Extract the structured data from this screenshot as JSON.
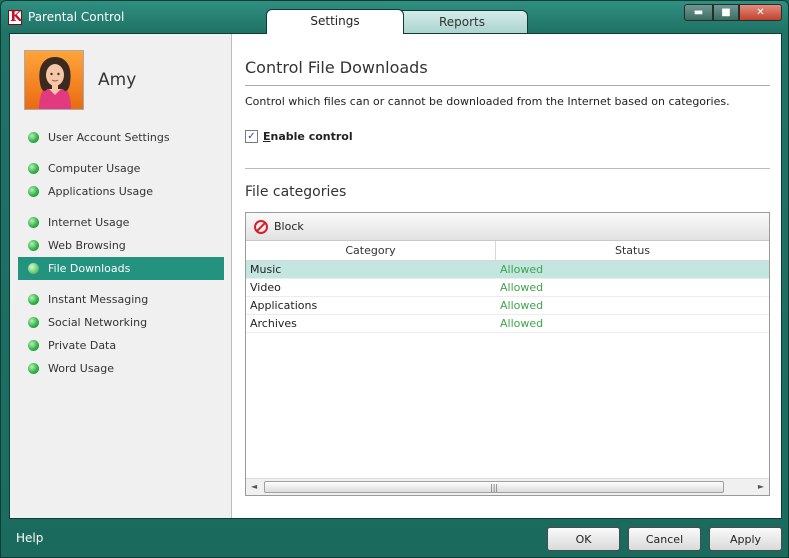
{
  "window": {
    "title": "Parental Control",
    "logo_letter": "K",
    "tabs": [
      {
        "label": "Settings",
        "active": true
      },
      {
        "label": "Reports",
        "active": false
      }
    ],
    "controls": {
      "minimize": "▬",
      "maximize": "■",
      "close": "✕"
    }
  },
  "sidebar": {
    "user_name": "Amy",
    "items": [
      {
        "label": "User Account Settings",
        "active": false
      },
      {
        "label": "Computer Usage",
        "active": false
      },
      {
        "label": "Applications Usage",
        "active": false
      },
      {
        "label": "Internet Usage",
        "active": false
      },
      {
        "label": "Web Browsing",
        "active": false
      },
      {
        "label": "File Downloads",
        "active": true
      },
      {
        "label": "Instant Messaging",
        "active": false
      },
      {
        "label": "Social Networking",
        "active": false
      },
      {
        "label": "Private Data",
        "active": false
      },
      {
        "label": "Word Usage",
        "active": false
      }
    ]
  },
  "main": {
    "title": "Control File Downloads",
    "description": "Control which files can or cannot be downloaded from the Internet based on categories.",
    "enable_control": {
      "label_first": "E",
      "label_rest": "nable control",
      "checked": true,
      "check_glyph": "✓"
    },
    "section_title": "File categories",
    "toolbar": {
      "block_label": "Block"
    },
    "table": {
      "columns": [
        "Category",
        "Status"
      ],
      "rows": [
        {
          "category": "Music",
          "status": "Allowed",
          "selected": true
        },
        {
          "category": "Video",
          "status": "Allowed",
          "selected": false
        },
        {
          "category": "Applications",
          "status": "Allowed",
          "selected": false
        },
        {
          "category": "Archives",
          "status": "Allowed",
          "selected": false
        }
      ]
    },
    "scrollbar": {
      "left_arrow": "◄",
      "right_arrow": "►",
      "grip": "|||"
    }
  },
  "footer": {
    "help": "Help",
    "ok": "OK",
    "cancel": "Cancel",
    "apply": "Apply"
  },
  "colors": {
    "frame": "#1f7467",
    "accent_selected": "#23927f",
    "row_selected": "#c4e6e0",
    "status_allowed": "#3fa44a",
    "block_icon": "#d8202a"
  }
}
